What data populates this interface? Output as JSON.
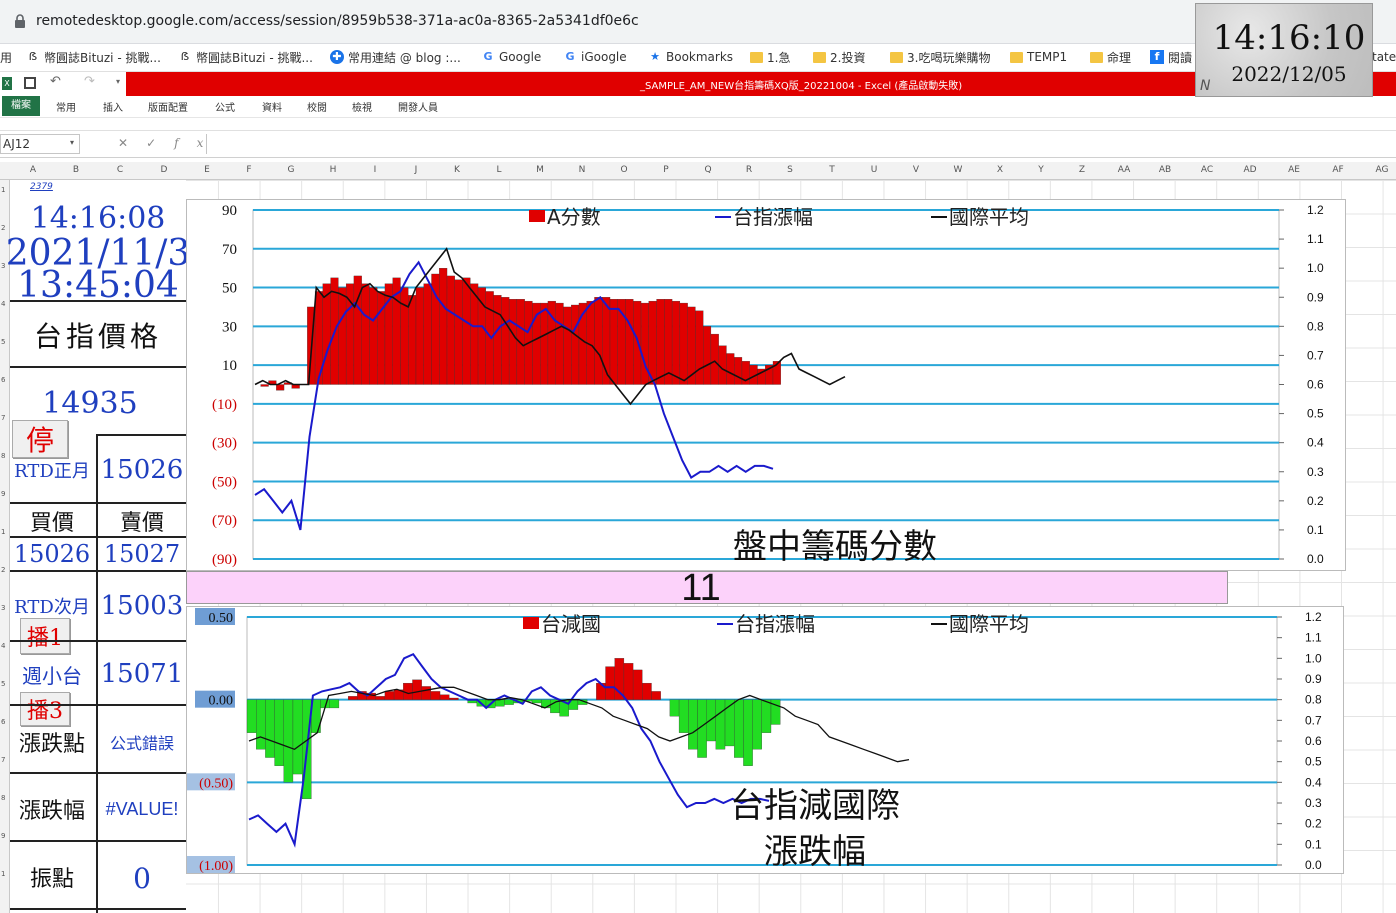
{
  "browser": {
    "url": "remotedesktop.google.com/access/session/8959b538-371a-ac0a-8365-2a5341df0e6c",
    "bookmarks": [
      {
        "label": "用",
        "icon": "apps-icon"
      },
      {
        "label": "幣圓誌Bituzi - 挑戰...",
        "icon": "bituzi-icon"
      },
      {
        "label": "幣圓誌Bituzi - 挑戰...",
        "icon": "bituzi-icon"
      },
      {
        "label": "常用連結 @ blog :...",
        "icon": "blog-icon"
      },
      {
        "label": "Google",
        "icon": "google-icon"
      },
      {
        "label": "iGoogle",
        "icon": "google-icon"
      },
      {
        "label": "Bookmarks",
        "icon": "star-icon"
      },
      {
        "label": "1.急",
        "icon": "folder-icon"
      },
      {
        "label": "2.投資",
        "icon": "folder-icon"
      },
      {
        "label": "3.吃喝玩樂購物",
        "icon": "folder-icon"
      },
      {
        "label": "TEMP1",
        "icon": "folder-icon"
      },
      {
        "label": "命理",
        "icon": "folder-icon"
      },
      {
        "label": "閱讀",
        "icon": "facebook-icon"
      }
    ],
    "bookmark_overflow": "tate"
  },
  "excel": {
    "title": "_SAMPLE_AM_NEW台指籌碼XQ版_20221004 - Excel (產品啟動失敗)",
    "ribbon_tabs": [
      "檔案",
      "常用",
      "插入",
      "版面配置",
      "公式",
      "資料",
      "校閱",
      "檢視",
      "開發人員"
    ],
    "name_box": "AJ12",
    "columns": [
      "A",
      "B",
      "C",
      "D",
      "E",
      "F",
      "G",
      "H",
      "I",
      "J",
      "K",
      "L",
      "M",
      "N",
      "O",
      "P",
      "Q",
      "R",
      "S",
      "T",
      "U",
      "V",
      "W",
      "X",
      "Y",
      "Z",
      "AA",
      "AB",
      "AC",
      "AD",
      "AE",
      "AF",
      "AG"
    ],
    "rows": [
      "1",
      "2",
      "3",
      "4",
      "5",
      "6",
      "7",
      "8",
      "9",
      "1",
      "2",
      "3",
      "4",
      "5",
      "6",
      "7",
      "8",
      "9",
      "1"
    ]
  },
  "panel": {
    "link_value": "2379",
    "time_now": "14:16:08",
    "date": "2021/11/3",
    "time_data": "13:45:04",
    "index_label": "台指價格",
    "index_value": "14935",
    "stop_button": "停",
    "rtd_front_label": "RTD正月",
    "rtd_front_value": "15026",
    "bid_label": "買價",
    "ask_label": "賣價",
    "bid_value": "15026",
    "ask_value": "15027",
    "rtd_next_label": "RTD次月",
    "rtd_next_value": "15003",
    "play1_button": "播1",
    "weekly_label": "週小台",
    "weekly_value": "15071",
    "play3_button": "播3",
    "change_pts_label": "漲跌點",
    "change_pts_value": "公式錯誤",
    "change_pct_label": "漲跌幅",
    "change_pct_value": "#VALUE!",
    "swing_label": "振點",
    "swing_value": "0"
  },
  "banner": {
    "value": "11"
  },
  "clock": {
    "time": "14:16:10",
    "date": "2022/12/05",
    "mark": "N"
  },
  "chart_data": [
    {
      "type": "area",
      "title": "盤中籌碼分數",
      "legend": [
        "A分數",
        "台指漲幅",
        "國際平均"
      ],
      "legend_placement": "top",
      "colors": {
        "area": "#e00000",
        "index": "#1a1acc",
        "intl": "#111111",
        "grid": "#2aa7d8"
      },
      "y_left_ticks": [
        "90",
        "70",
        "50",
        "30",
        "10",
        "(10)",
        "(30)",
        "(50)",
        "(70)",
        "(90)"
      ],
      "y_left_range": [
        -90,
        90
      ],
      "y_right_ticks": [
        "1.2",
        "1.1",
        "1.0",
        "0.9",
        "0.8",
        "0.7",
        "0.6",
        "0.5",
        "0.4",
        "0.3",
        "0.2",
        "0.1",
        "0.0"
      ],
      "y_right_range": [
        0,
        1.2
      ],
      "series": [
        {
          "name": "A分數",
          "axis": "left",
          "values": [
            0,
            -1,
            2,
            -3,
            1,
            -2,
            0,
            40,
            48,
            52,
            55,
            50,
            52,
            56,
            52,
            50,
            48,
            52,
            55,
            50,
            46,
            50,
            52,
            57,
            60,
            56,
            54,
            55,
            52,
            50,
            48,
            46,
            45,
            44,
            44,
            43,
            42,
            42,
            43,
            42,
            40,
            41,
            42,
            43,
            45,
            45,
            44,
            44,
            44,
            43,
            42,
            43,
            44,
            44,
            43,
            42,
            40,
            38,
            30,
            26,
            20,
            16,
            14,
            12,
            10,
            8,
            10,
            12
          ]
        },
        {
          "name": "台指漲幅",
          "axis": "right",
          "values": [
            0.22,
            0.24,
            0.2,
            0.16,
            0.2,
            0.1,
            0.42,
            0.62,
            0.72,
            0.8,
            0.85,
            0.88,
            0.84,
            0.82,
            0.86,
            0.9,
            0.92,
            0.98,
            1.02,
            0.96,
            0.9,
            0.86,
            0.84,
            0.82,
            0.8,
            0.8,
            0.76,
            0.8,
            0.82,
            0.8,
            0.78,
            0.84,
            0.86,
            0.82,
            0.8,
            0.78,
            0.84,
            0.88,
            0.9,
            0.86,
            0.86,
            0.82,
            0.76,
            0.66,
            0.6,
            0.5,
            0.42,
            0.34,
            0.28,
            0.3,
            0.3,
            0.32,
            0.3,
            0.32,
            0.3,
            0.32,
            0.32,
            0.31
          ]
        },
        {
          "name": "國際平均",
          "axis": "left",
          "values": [
            0,
            2,
            0,
            0,
            2,
            0,
            0,
            0,
            50,
            45,
            48,
            47,
            45,
            40,
            50,
            52,
            48,
            46,
            45,
            42,
            40,
            50,
            55,
            60,
            65,
            70,
            58,
            55,
            50,
            45,
            40,
            38,
            36,
            30,
            24,
            20,
            22,
            24,
            26,
            28,
            30,
            28,
            25,
            22,
            20,
            15,
            5,
            0,
            -5,
            -10,
            -5,
            0,
            2,
            4,
            6,
            4,
            2,
            5,
            8,
            10,
            12,
            8,
            6,
            4,
            2,
            4,
            6,
            8,
            10,
            14,
            16,
            8,
            6,
            4,
            2,
            0,
            2,
            4
          ]
        }
      ]
    },
    {
      "type": "area",
      "title": "台指減國際 漲跌幅",
      "legend": [
        "台減國",
        "台指漲幅",
        "國際平均"
      ],
      "legend_placement": "top",
      "colors": {
        "positive": "#e00000",
        "negative": "#22dd22",
        "index": "#1a1acc",
        "intl": "#111111",
        "grid": "#2aa7d8"
      },
      "y_left_ticks": [
        "0.50",
        "0.00",
        "(0.50)",
        "(1.00)"
      ],
      "y_left_range": [
        -1.0,
        0.5
      ],
      "y_right_ticks": [
        "1.2",
        "1.1",
        "1.0",
        "0.9",
        "0.8",
        "0.7",
        "0.6",
        "0.5",
        "0.4",
        "0.3",
        "0.2",
        "0.1",
        "0.0"
      ],
      "y_right_range": [
        0,
        1.2
      ],
      "series": [
        {
          "name": "台減國",
          "axis": "left",
          "values": [
            -0.2,
            -0.3,
            -0.35,
            -0.4,
            -0.5,
            -0.45,
            -0.6,
            -0.2,
            -0.05,
            -0.05,
            0,
            0.02,
            0.05,
            0.04,
            0.02,
            0.05,
            0.06,
            0.1,
            0.12,
            0.08,
            0.05,
            0.03,
            0.01,
            0,
            -0.02,
            -0.04,
            -0.05,
            -0.04,
            -0.03,
            -0.02,
            -0.01,
            -0.02,
            -0.05,
            -0.08,
            -0.1,
            -0.06,
            -0.03,
            0,
            0.1,
            0.2,
            0.25,
            0.22,
            0.18,
            0.1,
            0.05,
            0,
            -0.1,
            -0.2,
            -0.3,
            -0.35,
            -0.25,
            -0.3,
            -0.28,
            -0.35,
            -0.4,
            -0.3,
            -0.2,
            -0.15
          ]
        },
        {
          "name": "台指漲幅",
          "axis": "right",
          "values": [
            0.22,
            0.24,
            0.2,
            0.16,
            0.2,
            0.1,
            0.42,
            0.82,
            0.84,
            0.85,
            0.86,
            0.88,
            0.84,
            0.82,
            0.86,
            0.9,
            0.92,
            1.0,
            1.02,
            0.96,
            0.9,
            0.86,
            0.84,
            0.82,
            0.8,
            0.8,
            0.76,
            0.8,
            0.82,
            0.8,
            0.78,
            0.84,
            0.86,
            0.82,
            0.8,
            0.78,
            0.84,
            0.88,
            0.9,
            0.86,
            0.86,
            0.82,
            0.76,
            0.66,
            0.6,
            0.5,
            0.42,
            0.34,
            0.28,
            0.3,
            0.3,
            0.32,
            0.3,
            0.32,
            0.3,
            0.32,
            0.32,
            0.31
          ]
        },
        {
          "name": "國際平均",
          "axis": "right",
          "values": [
            0.6,
            0.62,
            0.6,
            0.58,
            0.56,
            0.6,
            0.64,
            0.82,
            0.83,
            0.84,
            0.83,
            0.82,
            0.84,
            0.85,
            0.83,
            0.84,
            0.85,
            0.86,
            0.86,
            0.84,
            0.82,
            0.8,
            0.8,
            0.81,
            0.8,
            0.78,
            0.76,
            0.79,
            0.8,
            0.8,
            0.78,
            0.76,
            0.72,
            0.7,
            0.68,
            0.66,
            0.62,
            0.6,
            0.62,
            0.64,
            0.68,
            0.72,
            0.76,
            0.8,
            0.82,
            0.8,
            0.78,
            0.76,
            0.72,
            0.7,
            0.68,
            0.62,
            0.6,
            0.58,
            0.56,
            0.54,
            0.52,
            0.5,
            0.51
          ]
        }
      ]
    }
  ]
}
